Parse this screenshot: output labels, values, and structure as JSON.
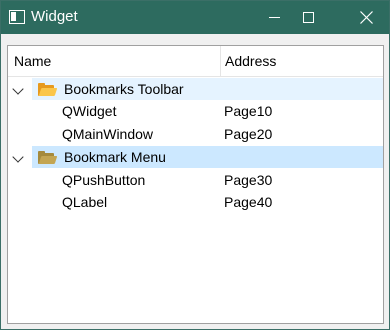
{
  "window": {
    "title": "Widget"
  },
  "tree": {
    "columns": {
      "name": "Name",
      "address": "Address"
    },
    "groups": [
      {
        "name": "Bookmarks Toolbar",
        "children": [
          {
            "name": "QWidget",
            "address": "Page10"
          },
          {
            "name": "QMainWindow",
            "address": "Page20"
          }
        ]
      },
      {
        "name": "Bookmark Menu",
        "children": [
          {
            "name": "QPushButton",
            "address": "Page30"
          },
          {
            "name": "QLabel",
            "address": "Page40"
          }
        ]
      }
    ]
  },
  "colors": {
    "titlebar": "#2d6b5f",
    "selection": "#cce8ff",
    "hover": "#e5f3ff"
  },
  "icons": {
    "app": "window-icon",
    "group_open": "folder-open-icon",
    "group_closed": "folder-icon",
    "expand": "chevron-down-icon"
  }
}
